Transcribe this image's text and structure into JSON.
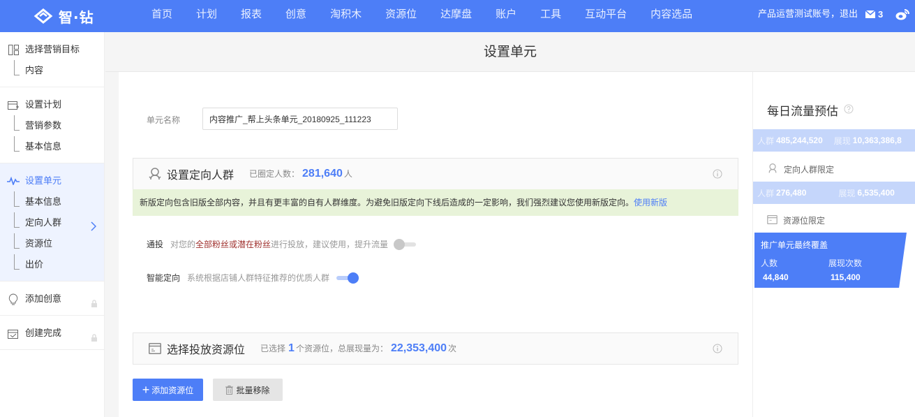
{
  "brand": {
    "logo_text": "智·钻"
  },
  "nav": {
    "items": [
      "首页",
      "计划",
      "报表",
      "创意",
      "淘积木",
      "资源位",
      "达摩盘",
      "账户",
      "工具",
      "互动平台",
      "内容选品"
    ]
  },
  "user": {
    "account_text": "产品运营测试账号，退出",
    "mail_count": "3"
  },
  "sidebar": {
    "groups": [
      {
        "label": "选择营销目标",
        "icon": "grid-icon",
        "subs": [
          "内容"
        ]
      },
      {
        "label": "设置计划",
        "icon": "plan-icon",
        "subs": [
          "营销参数",
          "基本信息"
        ]
      },
      {
        "label": "设置单元",
        "icon": "pulse-icon",
        "subs": [
          "基本信息",
          "定向人群",
          "资源位",
          "出价"
        ]
      },
      {
        "label": "添加创意",
        "icon": "bulb-icon",
        "subs": []
      },
      {
        "label": "创建完成",
        "icon": "check-calendar-icon",
        "subs": []
      }
    ]
  },
  "page": {
    "title": "设置单元"
  },
  "form": {
    "unit_name_label": "单元名称",
    "unit_name_value": "内容推广_帮上头条单元_20180925_111223"
  },
  "targeting": {
    "title": "设置定向人群",
    "count_label": "已圈定人数：",
    "count_value": "281,640",
    "count_unit": "人",
    "notice_text": "新版定向包含旧版全部内容，并且有更丰富的自有人群维度。为避免旧版定向下线后造成的一定影响，我们强烈建议您使用新版定向。",
    "notice_link": "使用新版",
    "options": [
      {
        "label": "通投",
        "desc_before": "对您的",
        "desc_highlight": "全部粉丝或潜在粉丝",
        "desc_after": "进行投放，建议使用，提升流量",
        "enabled": false
      },
      {
        "label": "智能定向",
        "desc_before": "系统根据店铺人群特征推荐的优质人群",
        "desc_highlight": "",
        "desc_after": "",
        "enabled": true
      }
    ]
  },
  "placement": {
    "title": "选择投放资源位",
    "selected_label": "已选择",
    "selected_count": "1",
    "selected_unit": "个资源位，总展现量为：",
    "total_impressions": "22,353,400",
    "impressions_unit": "次",
    "add_button": "添加资源位",
    "remove_button": "批量移除"
  },
  "forecast": {
    "title": "每日流量预估",
    "row1": {
      "people_label": "人群",
      "people_value": "485,244,520",
      "impr_label": "展现",
      "impr_value": "10,363,386,8"
    },
    "targeting_limit_label": "定向人群限定",
    "row2": {
      "people_label": "人群",
      "people_value": "276,480",
      "impr_label": "展现",
      "impr_value": "6,535,400"
    },
    "placement_limit_label": "资源位限定",
    "final": {
      "title": "推广单元最终覆盖",
      "people_label": "人数",
      "people_value": "44,840",
      "impr_label": "展现次数",
      "impr_value": "115,400"
    }
  },
  "colors": {
    "accent": "#4d7ef7",
    "notice_bg": "#e8f3d9",
    "highlight": "#a0322f"
  }
}
